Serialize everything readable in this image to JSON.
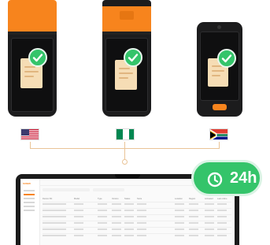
{
  "badge": {
    "label": "24h",
    "icon": "clock-icon",
    "color": "#34c46a"
  },
  "terminals": [
    {
      "variant": "orange-top printer",
      "status": "check-icon"
    },
    {
      "variant": "orange-top printer",
      "status": "check-icon"
    },
    {
      "variant": "black",
      "status": "check-icon"
    }
  ],
  "flags": [
    "united-states-flag",
    "nigeria-flag",
    "south-africa-flag"
  ],
  "dashboard": {
    "logo": "SUNMI",
    "header": "",
    "columns": [
      "Device SN",
      "Model",
      "Type",
      "Version",
      "Status",
      "Store",
      "Location",
      "Region",
      "Activated",
      "Last online"
    ],
    "rows": 6
  },
  "colors": {
    "accent": "#f7841d",
    "success": "#34c46a",
    "device": "#1c1c1d"
  }
}
